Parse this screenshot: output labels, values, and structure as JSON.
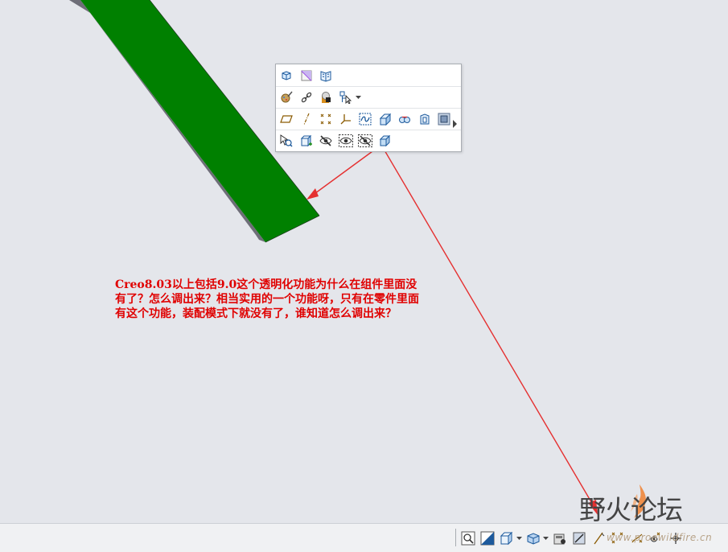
{
  "annotation": {
    "text": "Creo8.03以上包括9.0这个透明化功能为什么在组件里面没有了？怎么调出来？相当实用的一个功能呀，只有在零件里面有这个功能，装配模式下就没有了，谁知道怎么调出来？"
  },
  "mini_toolbar": {
    "row1": [
      "display-style-icon",
      "default-orientation-icon",
      "saved-views-icon"
    ],
    "row2": [
      "appearance-gallery-icon",
      "chain-icon",
      "render-icon",
      "select-filter-icon"
    ],
    "row3": [
      "plane-icon",
      "axis-icon",
      "point-icon",
      "csys-icon",
      "sketch-icon",
      "extrude-icon",
      "round-icon",
      "shell-icon",
      "pattern-icon"
    ],
    "row4": [
      "zoom-select-icon",
      "new-component-icon",
      "hide-icon",
      "show-icon",
      "unhide-all-icon",
      "transparency-icon"
    ]
  },
  "model": {
    "color": "#008000",
    "edge_color": "#6e6e78"
  },
  "watermark": {
    "title": "野火论坛",
    "url": "www.proewildfire.cn"
  },
  "colors": {
    "annotation": "#e00000",
    "arrow": "#e53030",
    "background": "#e4e6eb"
  }
}
